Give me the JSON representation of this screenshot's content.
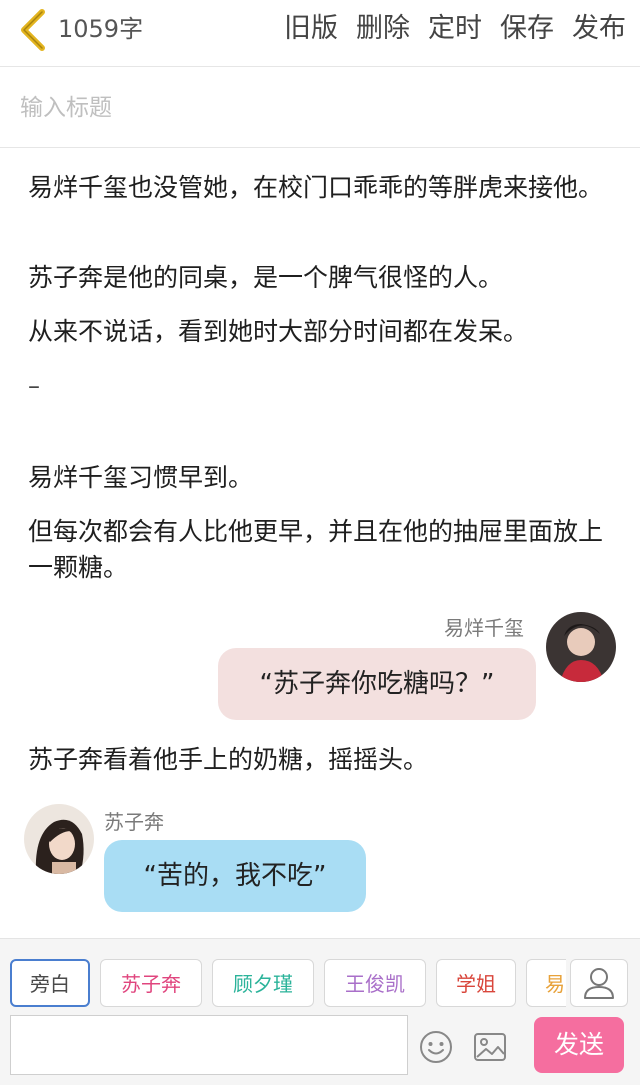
{
  "header": {
    "word_count": "1059字",
    "actions": [
      "旧版",
      "删除",
      "定时",
      "保存",
      "发布"
    ]
  },
  "title_input": {
    "placeholder": "输入标题",
    "value": ""
  },
  "body": {
    "paragraphs": [
      "易烊千玺也没管她，在校门口乖乖的等胖虎来接他。",
      "苏子奔是他的同桌，是一个脾气很怪的人。",
      "从来不说话，看到她时大部分时间都在发呆。",
      "易烊千玺习惯早到。",
      "但每次都会有人比他更早，并且在他的抽屉里面放上一颗糖。",
      "苏子奔看着他手上的奶糖，摇摇头。"
    ],
    "separator": "–"
  },
  "dialogues": [
    {
      "speaker": "易烊千玺",
      "text": "“苏子奔你吃糖吗？”",
      "side": "right",
      "bubble_color": "#f3e0df"
    },
    {
      "speaker": "苏子奔",
      "text": "“苦的，我不吃”",
      "side": "left",
      "bubble_color": "#a9ddf4"
    }
  ],
  "toolbar": {
    "characters": [
      {
        "label": "旁白",
        "color": "#4a4a4a",
        "selected": true
      },
      {
        "label": "苏子奔",
        "color": "#e0457e",
        "selected": false
      },
      {
        "label": "顾夕瑾",
        "color": "#2bb39a",
        "selected": false
      },
      {
        "label": "王俊凯",
        "color": "#a96fc9",
        "selected": false
      },
      {
        "label": "学姐",
        "color": "#d9463b",
        "selected": false
      },
      {
        "label": "易",
        "color": "#e8a23a",
        "selected": false
      }
    ],
    "message_value": "",
    "send_label": "发送",
    "icons": [
      "person-icon",
      "emoji-icon",
      "image-icon"
    ],
    "send_color": "#f56e9f"
  }
}
